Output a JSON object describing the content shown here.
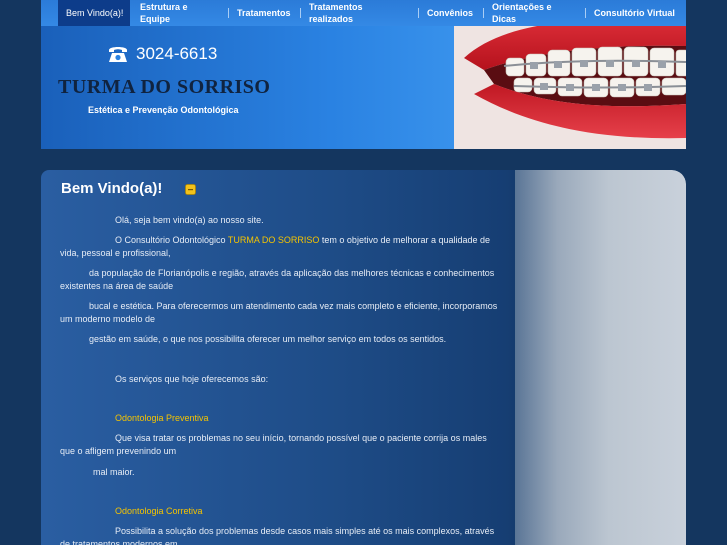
{
  "nav": {
    "items": [
      {
        "label": "Bem Vindo(a)!"
      },
      {
        "label": "Estrutura e Equipe"
      },
      {
        "label": "Tratamentos"
      },
      {
        "label": "Tratamentos realizados"
      },
      {
        "label": "Convênios"
      },
      {
        "label": "Orientações e Dicas"
      },
      {
        "label": "Consultório Virtual"
      }
    ]
  },
  "header": {
    "phone": "3024-6613",
    "brand": "TURMA DO SORRISO",
    "tagline": "Estética e Prevenção Odontológica"
  },
  "content": {
    "heading": "Bem Vindo(a)!",
    "greeting": "Olá, seja bem vindo(a) ao nosso site.",
    "intro_a": " O Consultório Odontológico ",
    "intro_brand": "TURMA DO SORRISO",
    "intro_b": " tem o objetivo de melhorar a qualidade de vida, pessoal e profissional,",
    "p2": "da população de Florianópolis e região, através da aplicação das melhores técnicas e conhecimentos existentes na área de saúde",
    "p3": "bucal e estética. Para oferecermos um atendimento cada vez mais completo e eficiente, incorporamos um moderno modelo de",
    "p4": "gestão em saúde, o que nos possibilita oferecer um melhor serviço em todos os sentidos.",
    "services_intro": "Os serviços que hoje oferecemos são:",
    "service1_title": "Odontologia Preventiva",
    "service1_text_a": "  Que visa tratar os problemas no seu início, tornando possível que o paciente corrija os males que o afligem prevenindo um",
    "service1_text_b": "mal maior.",
    "service2_title": "Odontologia Corretiva",
    "service2_text": "Possibilita a solução dos problemas desde casos mais simples até os mais complexos, através de tratamentos modernos em"
  },
  "colors": {
    "accent": "#f5c400",
    "nav_active": "#0d3c8a",
    "panel": "#1e4c87"
  }
}
